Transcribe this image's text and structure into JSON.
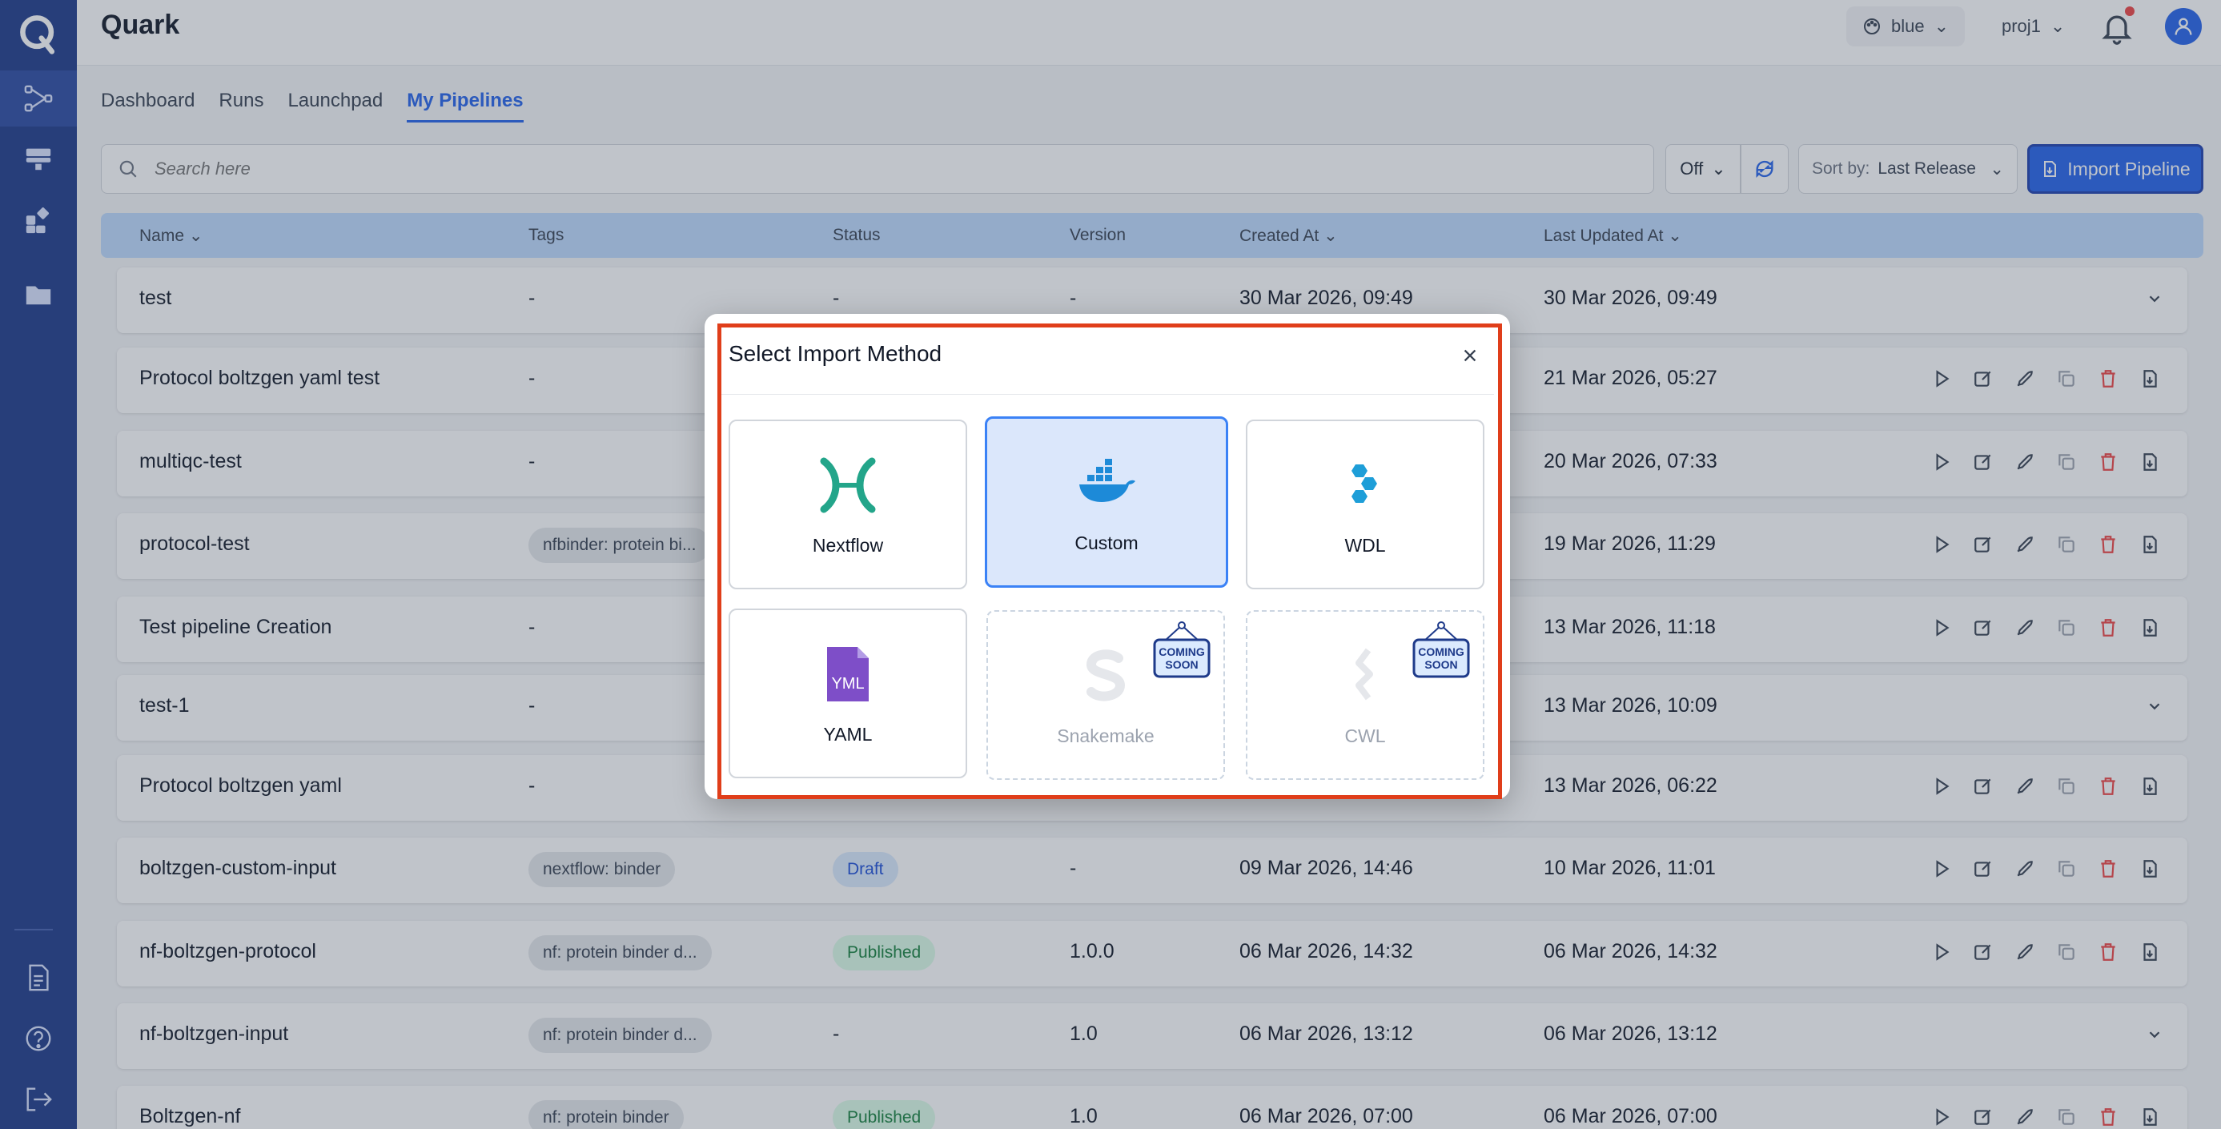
{
  "app": {
    "title": "Quark"
  },
  "header": {
    "theme": "blue",
    "project": "proj1"
  },
  "tabs": [
    "Dashboard",
    "Runs",
    "Launchpad",
    "My Pipelines"
  ],
  "toolbar": {
    "search_placeholder": "Search here",
    "filter_value": "Off",
    "sort_label": "Sort by:",
    "sort_value": "Last Release",
    "import_label": "Import Pipeline"
  },
  "table": {
    "columns": [
      "Name",
      "Tags",
      "Status",
      "Version",
      "Created At",
      "Last Updated At"
    ],
    "rows": [
      {
        "name": "test",
        "tag": "-",
        "status": "-",
        "version": "-",
        "created": "30 Mar 2026, 09:49",
        "updated": "30 Mar 2026, 09:49",
        "expand": true
      },
      {
        "name": "Protocol boltzgen yaml test",
        "tag": "-",
        "status": "",
        "version": "",
        "created": "",
        "updated": "21 Mar 2026, 05:27",
        "expand": false
      },
      {
        "name": "multiqc-test",
        "tag": "-",
        "status": "",
        "version": "",
        "created": "",
        "updated": "20 Mar 2026, 07:33",
        "expand": false
      },
      {
        "name": "protocol-test",
        "tag": "nfbinder: protein bi...",
        "status": "",
        "version": "",
        "created": "",
        "updated": "19 Mar 2026, 11:29",
        "expand": false
      },
      {
        "name": "Test pipeline Creation",
        "tag": "-",
        "status": "",
        "version": "",
        "created": "",
        "updated": "13 Mar 2026, 11:18",
        "expand": false
      },
      {
        "name": "test-1",
        "tag": "-",
        "status": "",
        "version": "",
        "created": "",
        "updated": "13 Mar 2026, 10:09",
        "expand": true
      },
      {
        "name": "Protocol boltzgen yaml",
        "tag": "-",
        "status": "",
        "version": "",
        "created": "",
        "updated": "13 Mar 2026, 06:22",
        "expand": false
      },
      {
        "name": "boltzgen-custom-input",
        "tag": "nextflow: binder",
        "status": "Draft",
        "version": "-",
        "created": "09 Mar 2026, 14:46",
        "updated": "10 Mar 2026, 11:01",
        "expand": false
      },
      {
        "name": "nf-boltzgen-protocol",
        "tag": "nf: protein binder d...",
        "status": "Published",
        "version": "1.0.0",
        "created": "06 Mar 2026, 14:32",
        "updated": "06 Mar 2026, 14:32",
        "expand": false
      },
      {
        "name": "nf-boltzgen-input",
        "tag": "nf: protein binder d...",
        "status": "-",
        "version": "1.0",
        "created": "06 Mar 2026, 13:12",
        "updated": "06 Mar 2026, 13:12",
        "expand": true
      },
      {
        "name": "Boltzgen-nf",
        "tag": "nf: protein binder",
        "status": "Published",
        "version": "1.0",
        "created": "06 Mar 2026, 07:00",
        "updated": "06 Mar 2026, 07:00",
        "expand": false
      }
    ]
  },
  "modal": {
    "title": "Select Import Method",
    "options": [
      {
        "label": "Nextflow",
        "state": "normal",
        "icon": "nextflow-icon"
      },
      {
        "label": "Custom",
        "state": "selected",
        "icon": "docker-icon"
      },
      {
        "label": "WDL",
        "state": "normal",
        "icon": "wdl-icon"
      },
      {
        "label": "YAML",
        "state": "normal",
        "icon": "yaml-icon"
      },
      {
        "label": "Snakemake",
        "state": "coming-soon",
        "icon": "snakemake-icon"
      },
      {
        "label": "CWL",
        "state": "coming-soon",
        "icon": "cwl-icon"
      }
    ],
    "badge_line1": "COMING",
    "badge_line2": "SOON",
    "yaml_icon_text": "YML"
  },
  "colors": {
    "primary": "#2563eb",
    "sidebar": "#1e3a8a",
    "highlight_frame": "#e03e1a"
  }
}
